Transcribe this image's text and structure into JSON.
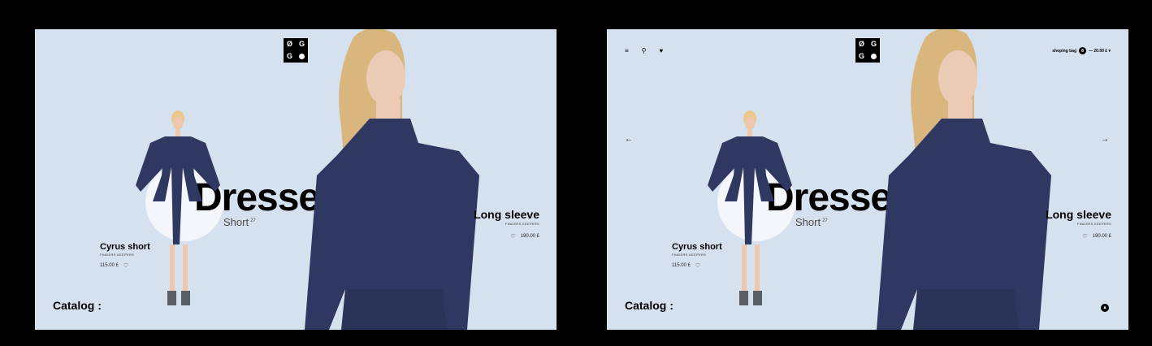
{
  "logo": {
    "tl": "Ø",
    "tr": "G",
    "bl": "G"
  },
  "hero": {
    "word": "Dresses",
    "sub": "Short",
    "sup": "27"
  },
  "product_left": {
    "title": "Cyrus short",
    "brand": "FINDERS KEEPERS",
    "price": "115.00 £"
  },
  "product_right": {
    "title": "Long sleeve",
    "brand": "FINDERS KEEPERS",
    "price": "190.00 £"
  },
  "catalog": "Catalog :",
  "header": {
    "bag_label": "shoping bag",
    "bag_count": "8",
    "total": "— 20.00 £ ▾"
  },
  "icons": {
    "menu": "≡",
    "search": "⚲",
    "heart": "♥",
    "heart_outline": "♡",
    "arrow_left": "←",
    "arrow_right": "→",
    "scroll": "▲"
  },
  "colors": {
    "background": "#d6e1ef",
    "dress": "#2e3860",
    "accent": "#000000"
  }
}
